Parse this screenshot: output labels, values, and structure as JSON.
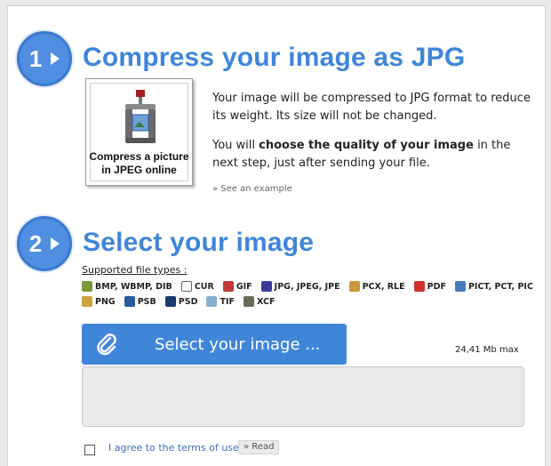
{
  "step1": {
    "number": "1",
    "title": "Compress your image as JPG",
    "thumbnail_caption_line1": "Compress a picture",
    "thumbnail_caption_line2": "in JPEG online",
    "paragraph1": "Your image will be compressed to JPG format to reduce its weight. Its size will not be changed.",
    "paragraph2_before": "You will ",
    "paragraph2_bold": "choose the quality of your image",
    "paragraph2_after": " in the next step, just after sending your file.",
    "example_link": "» See an example"
  },
  "step2": {
    "number": "2",
    "title": "Select your image",
    "supported_label": "Supported file types :",
    "file_types_row1": [
      {
        "label": "BMP, WBMP, DIB",
        "icon": "bmp-icon",
        "color": "#7a9a3a"
      },
      {
        "label": "CUR",
        "icon": "cursor-icon",
        "color": "#ffffff"
      },
      {
        "label": "GIF",
        "icon": "gif-icon",
        "color": "#c43a3a"
      },
      {
        "label": "JPG, JPEG, JPE",
        "icon": "jpg-icon",
        "color": "#3a3a9a"
      },
      {
        "label": "PCX, RLE",
        "icon": "pcx-icon",
        "color": "#c89a3a"
      },
      {
        "label": "PDF",
        "icon": "pdf-icon",
        "color": "#d03030"
      },
      {
        "label": "PICT, PCT, PIC",
        "icon": "pict-icon",
        "color": "#4a7ac0"
      }
    ],
    "file_types_row2": [
      {
        "label": "PNG",
        "icon": "png-icon",
        "color": "#d0a040"
      },
      {
        "label": "PSB",
        "icon": "psb-icon",
        "color": "#2a5aa0"
      },
      {
        "label": "PSD",
        "icon": "psd-icon",
        "color": "#1a3a70"
      },
      {
        "label": "TIF",
        "icon": "tif-icon",
        "color": "#8ab0d0"
      },
      {
        "label": "XCF",
        "icon": "xcf-icon",
        "color": "#6a6a5a"
      }
    ],
    "select_button": "Select your image ...",
    "max_size": "24,41 Mb max",
    "agree_text": "I agree to the terms of use",
    "read_button": "» Read"
  },
  "colors": {
    "accent": "#3f86d9",
    "badge": "#4f8ee0"
  }
}
